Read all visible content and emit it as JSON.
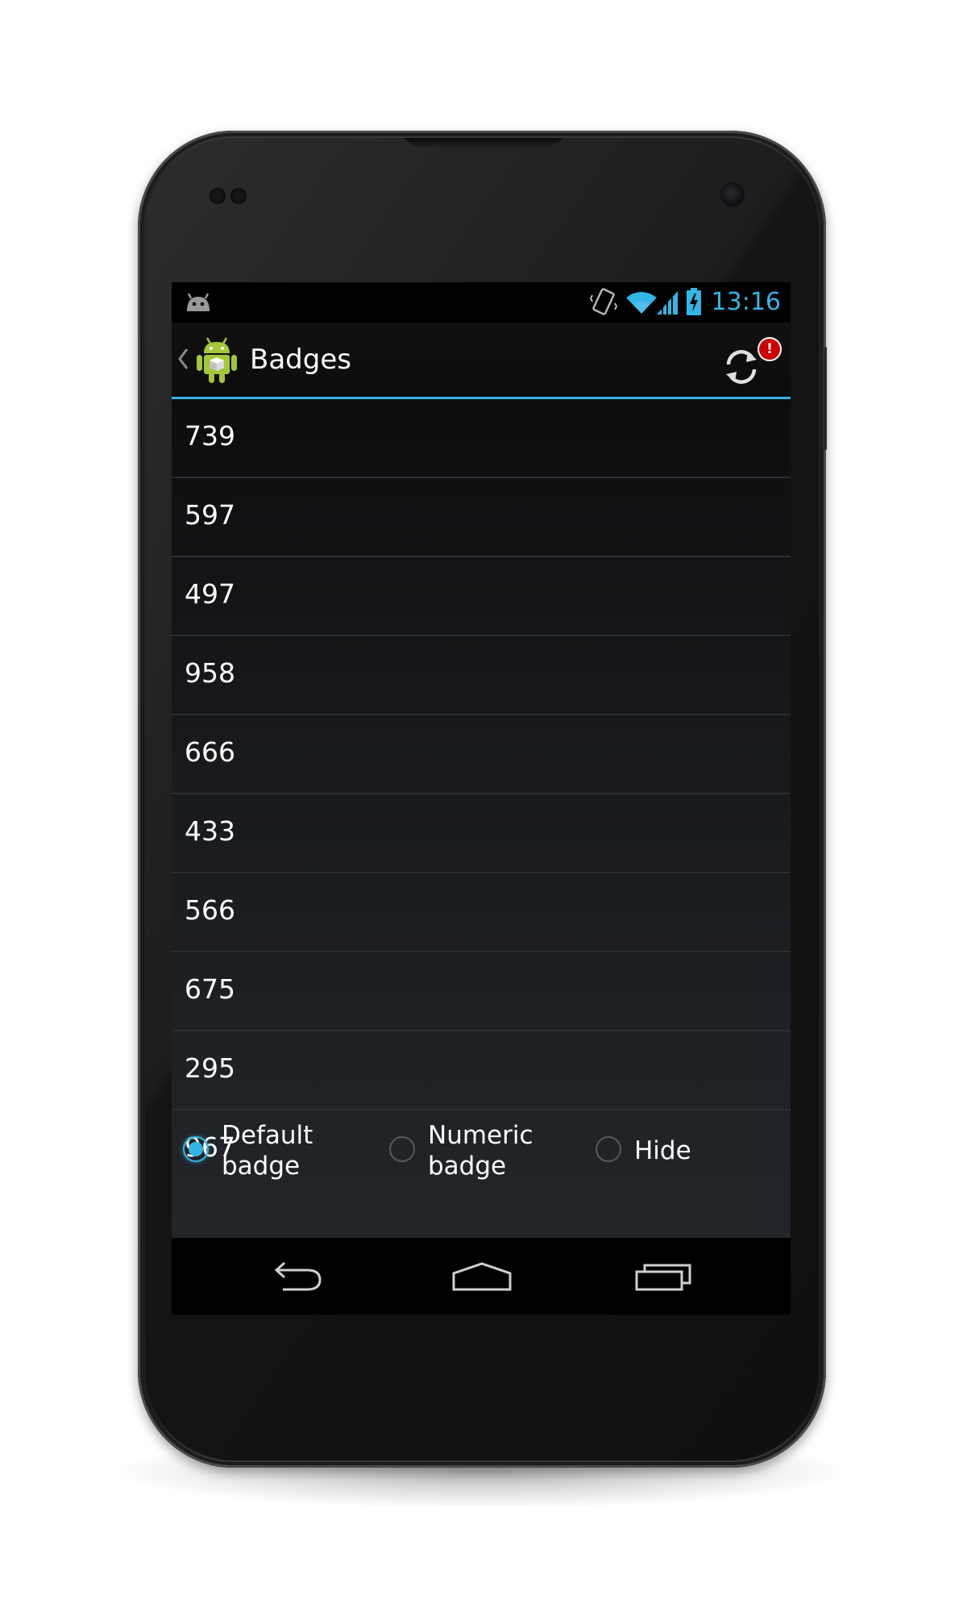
{
  "status_bar": {
    "time": "13:16",
    "notification_icon": "android-debug-icon",
    "icons": [
      "vibrate-icon",
      "wifi-icon",
      "signal-icon",
      "battery-charging-icon"
    ],
    "accent_color": "#33b5e5"
  },
  "action_bar": {
    "title": "Badges",
    "app_icon": "android-app-icon",
    "action_icon": "refresh-icon",
    "badge_text": "!",
    "badge_color": "#cc0000"
  },
  "list": {
    "items": [
      "739",
      "597",
      "497",
      "958",
      "666",
      "433",
      "566",
      "675",
      "295",
      "967"
    ]
  },
  "radio_group": {
    "options": [
      {
        "line1": "Default",
        "line2": "badge",
        "checked": true
      },
      {
        "line1": "Numeric",
        "line2": "badge",
        "checked": false
      },
      {
        "label": "Hide",
        "checked": false
      }
    ]
  },
  "nav_bar": {
    "buttons": [
      "back-icon",
      "home-icon",
      "recent-apps-icon"
    ]
  }
}
